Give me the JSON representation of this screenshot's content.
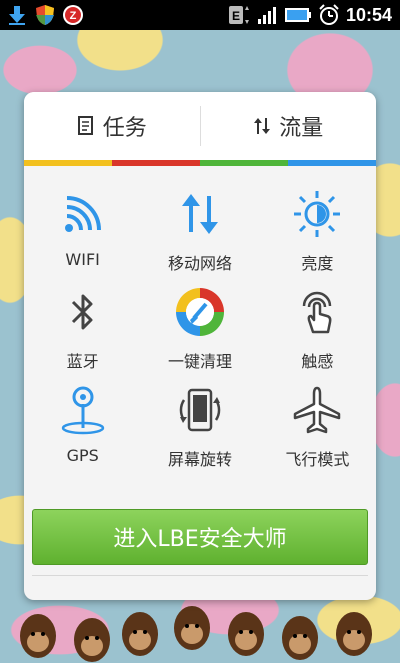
{
  "status_bar": {
    "time": "10:54",
    "left_icons": [
      "download-icon",
      "shield-icon",
      "z-app-icon"
    ],
    "right_icons": [
      "e-data-icon",
      "signal-icon",
      "battery-icon",
      "alarm-icon"
    ]
  },
  "tabs": [
    {
      "label": "任务",
      "icon": "task-document-icon"
    },
    {
      "label": "流量",
      "icon": "traffic-arrows-icon"
    }
  ],
  "color_strip": [
    "#f2c01e",
    "#d9362a",
    "#4fb53a",
    "#2f95e8"
  ],
  "toggles": [
    {
      "label": "WIFI",
      "icon": "wifi-icon"
    },
    {
      "label": "移动网络",
      "icon": "mobile-network-icon"
    },
    {
      "label": "亮度",
      "icon": "brightness-icon"
    },
    {
      "label": "蓝牙",
      "icon": "bluetooth-icon"
    },
    {
      "label": "一键清理",
      "icon": "one-key-clean-icon"
    },
    {
      "label": "触感",
      "icon": "haptic-touch-icon"
    },
    {
      "label": "GPS",
      "icon": "gps-icon"
    },
    {
      "label": "屏幕旋转",
      "icon": "screen-rotate-icon"
    },
    {
      "label": "飞行模式",
      "icon": "airplane-mode-icon"
    }
  ],
  "main_button": {
    "label": "进入LBE安全大师"
  },
  "colors": {
    "accent_blue": "#2f95e8",
    "icon_gray": "#444444",
    "button_green": "#6cbf3a"
  }
}
